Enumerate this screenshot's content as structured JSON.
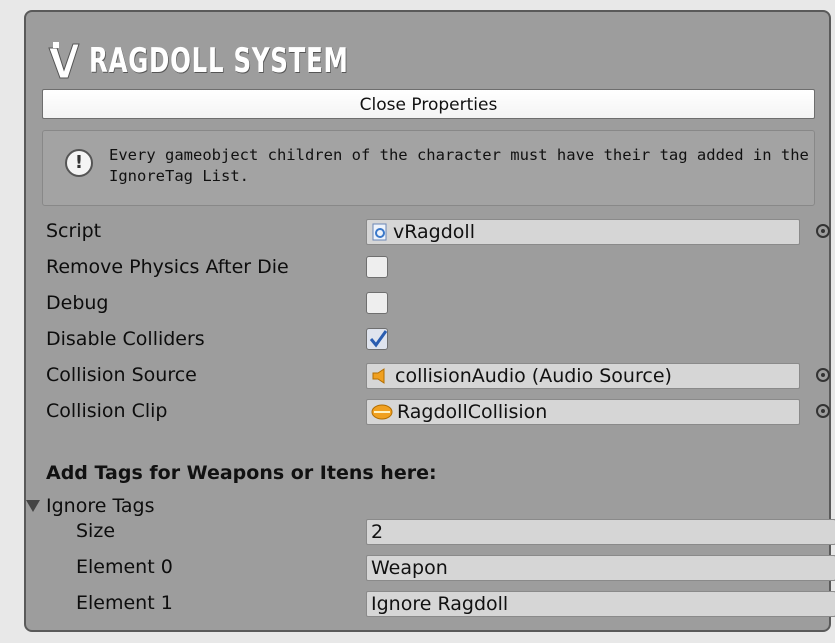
{
  "header": {
    "title": "RAGDOLL SYSTEM",
    "logo_icon": "v-logo-icon"
  },
  "close_button": "Close Properties",
  "help": {
    "icon": "exclamation-icon",
    "text": "Every gameobject children of the character must have their tag added in the IgnoreTag List."
  },
  "fields": {
    "script": {
      "label": "Script",
      "value": "vRagdoll",
      "icon": "script-file-icon"
    },
    "remove_physics": {
      "label": "Remove Physics After Die",
      "checked": false
    },
    "debug": {
      "label": "Debug",
      "checked": false
    },
    "disable_colliders": {
      "label": "Disable Colliders",
      "checked": true
    },
    "collision_source": {
      "label": "Collision Source",
      "value": "collisionAudio (Audio Source)",
      "icon": "audio-source-icon"
    },
    "collision_clip": {
      "label": "Collision Clip",
      "value": "RagdollCollision",
      "icon": "audio-clip-icon"
    }
  },
  "tags_section": {
    "title": "Add Tags for Weapons or Itens here:",
    "foldout_label": "Ignore Tags",
    "size_label": "Size",
    "size_value": "2",
    "elements": [
      {
        "label": "Element 0",
        "value": "Weapon"
      },
      {
        "label": "Element 1",
        "value": "Ignore Ragdoll"
      }
    ]
  },
  "colors": {
    "panel_bg": "#9d9d9d",
    "field_bg": "#d6d6d6",
    "check_blue": "#2a5db0"
  }
}
